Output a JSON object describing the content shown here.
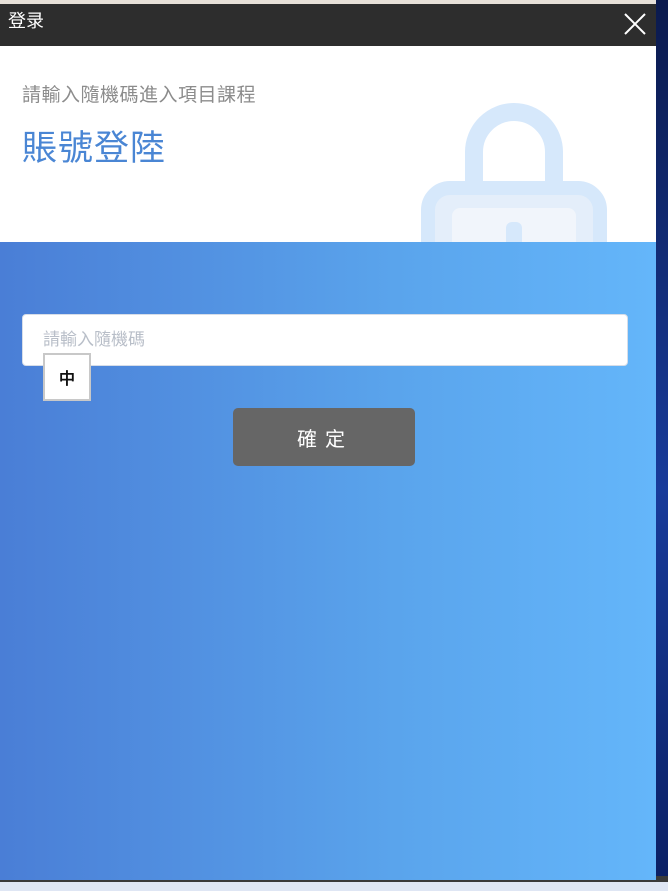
{
  "window": {
    "title": "登录",
    "close_icon": "close-icon"
  },
  "header": {
    "subtitle": "請輸入隨機碼進入項目課程",
    "title": "賬號登陸",
    "lock_icon": "lock-icon"
  },
  "form": {
    "code_placeholder": "請輸入隨機碼",
    "code_value": "",
    "ime_indicator": "中",
    "confirm_label": "確定"
  },
  "colors": {
    "titlebar": "#2d2d2d",
    "title_accent": "#4a86d4",
    "gradient_start": "#4a7ed6",
    "gradient_end": "#64b6fa",
    "button": "#666666"
  }
}
